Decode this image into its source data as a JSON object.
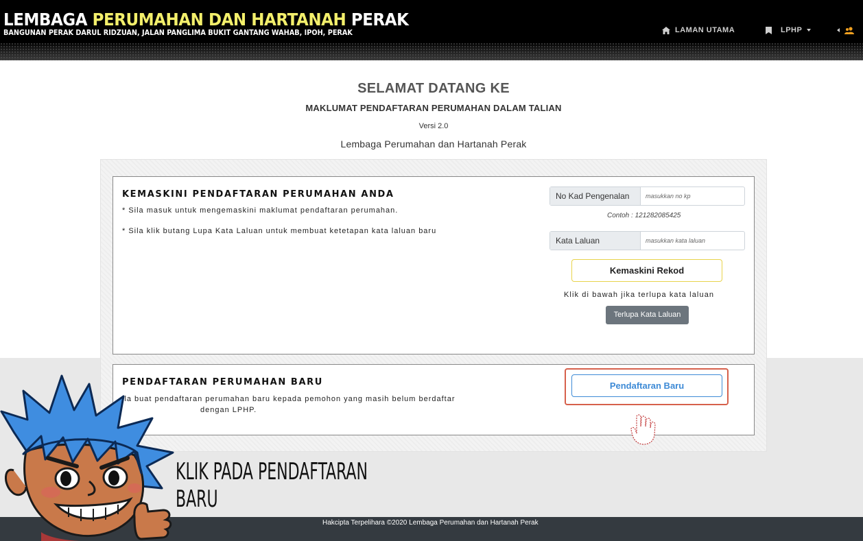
{
  "header": {
    "title_part1": "LEMBAGA ",
    "title_part2": "PERUMAHAN DAN HARTANAH",
    "title_part3": " PERAK",
    "subtitle": "BANGUNAN PERAK DARUL RIDZUAN, JALAN PANGLIMA BUKIT GANTANG WAHAB, IPOH, PERAK",
    "nav": {
      "home_label": "LAMAN UTAMA",
      "home_icon": "home-icon",
      "lphp_label": "LPHP",
      "lphp_icon": "bookmark-icon",
      "user_icon": "user-group-icon"
    },
    "accent_color": "#f3ef6b"
  },
  "welcome": {
    "title": "SELAMAT DATANG KE",
    "subtitle": "MAKLUMAT PENDAFTARAN PERUMAHAN DALAM TALIAN",
    "version": "Versi 2.0",
    "org": "Lembaga Perumahan dan Hartanah Perak"
  },
  "update_section": {
    "heading": "KEMASKINI PENDAFTARAN PERUMAHAN ANDA",
    "note1": "* Sila masuk untuk mengemaskini maklumat pendaftaran perumahan.",
    "note2": "* Sila klik butang Lupa Kata Laluan untuk membuat ketetapan kata laluan baru",
    "ic_label": "No Kad Pengenalan",
    "ic_placeholder": "masukkan no kp",
    "ic_example": "Contoh : 121282085425",
    "password_label": "Kata Laluan",
    "password_placeholder": "masukkan kata laluan",
    "submit_label": "Kemaskini Rekod",
    "forgot_text": "Klik di bawah jika terlupa kata laluan",
    "forgot_button": "Terlupa Kata Laluan"
  },
  "new_section": {
    "heading": "PENDAFTARAN PERUMAHAN BARU",
    "note_line1": "ila buat pendaftaran perumahan baru kepada pemohon yang masih belum berdaftar",
    "note_line2": "dengan LPHP.",
    "button_label": "Pendaftaran Baru",
    "highlight_color": "#d6604b",
    "button_color": "#3d8ad6"
  },
  "callout": {
    "line1": "KLIK PADA PENDAFTARAN",
    "line2": "BARU"
  },
  "footer": {
    "text": "Hakcipta Terpelihara ©2020 Lembaga Perumahan dan Hartanah Perak"
  }
}
